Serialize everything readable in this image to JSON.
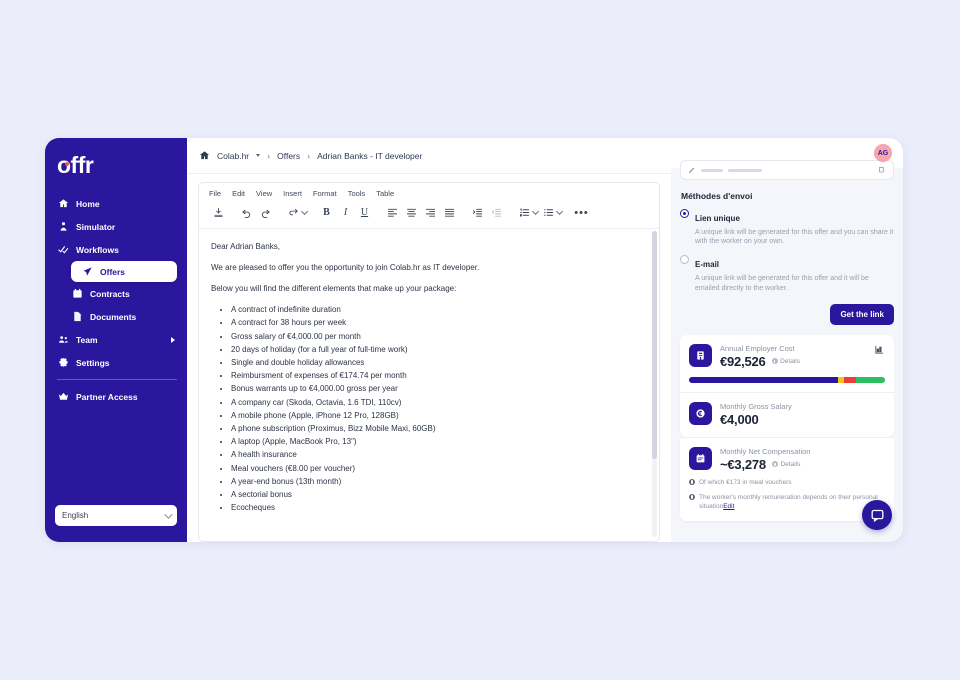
{
  "theme": {
    "brand": "#2b169e",
    "page_bg": "#ecedfb",
    "panel_bg": "#f5f6fb",
    "avatar_bg": "#f7a5ae",
    "accent_orange": "#f0593f"
  },
  "sidebar": {
    "logo_text": "offr",
    "items": [
      {
        "label": "Home",
        "icon": "home-icon",
        "level": 0,
        "active": false
      },
      {
        "label": "Simulator",
        "icon": "user-simulator-icon",
        "level": 0,
        "active": false
      },
      {
        "label": "Workflows",
        "icon": "workflows-icon",
        "level": 0,
        "active": false
      },
      {
        "label": "Offers",
        "icon": "paper-plane-icon",
        "level": 1,
        "active": true
      },
      {
        "label": "Contracts",
        "icon": "calendar-icon",
        "level": 1,
        "active": false
      },
      {
        "label": "Documents",
        "icon": "document-edit-icon",
        "level": 1,
        "active": false
      },
      {
        "label": "Team",
        "icon": "people-icon",
        "level": 0,
        "active": false,
        "has_chevron": true
      },
      {
        "label": "Settings",
        "icon": "gear-icon",
        "level": 0,
        "active": false
      }
    ],
    "footer_items": [
      {
        "label": "Partner Access",
        "icon": "crown-icon"
      }
    ],
    "language": {
      "value": "English",
      "chevron": "chevron-down-icon"
    }
  },
  "breadcrumb": {
    "home_icon": "home-icon",
    "items": [
      "Colab.hr",
      "Offers",
      "Adrian Banks - IT developer"
    ],
    "separator": "›"
  },
  "topbar": {
    "avatar_initials": "AG"
  },
  "editor": {
    "menus": [
      "File",
      "Edit",
      "View",
      "Insert",
      "Format",
      "Tools",
      "Table"
    ],
    "toolbar": [
      {
        "name": "save-icon",
        "label": ""
      },
      {
        "name": "undo-icon",
        "label": ""
      },
      {
        "name": "redo-icon",
        "label": ""
      },
      {
        "name": "merge-field-icon",
        "label": ""
      },
      {
        "name": "bold-button",
        "label": "B"
      },
      {
        "name": "italic-button",
        "label": "I"
      },
      {
        "name": "underline-button",
        "label": "U"
      },
      {
        "name": "align-left-icon",
        "label": ""
      },
      {
        "name": "align-center-icon",
        "label": ""
      },
      {
        "name": "align-right-icon",
        "label": ""
      },
      {
        "name": "align-justify-icon",
        "label": ""
      },
      {
        "name": "indent-increase-icon",
        "label": ""
      },
      {
        "name": "indent-decrease-icon",
        "label": ""
      },
      {
        "name": "ordered-list-icon",
        "label": ""
      },
      {
        "name": "bullet-list-icon",
        "label": ""
      },
      {
        "name": "more-options-icon",
        "label": "•••"
      }
    ],
    "document": {
      "greeting": "Dear Adrian Banks,",
      "intro": "We are pleased to offer you the opportunity to join Colab.hr as IT developer.",
      "lead_in": "Below you will find the different elements that make up your package:",
      "bullets": [
        "A contract of indefinite duration",
        "A contract for 38 hours per week",
        "Gross salary of €4,000.00 per month",
        "20 days of holiday (for a full year of full-time work)",
        "Single and double holiday allowances",
        "Reimbursment of expenses of €174.74 per month",
        "Bonus warrants up to €4,000.00 gross per year",
        "A company car (Skoda, Octavia, 1.6 TDI, 110cv)",
        "A mobile phone (Apple, iPhone 12 Pro, 128GB)",
        "A phone subscription (Proximus, Bizz Mobile Maxi, 60GB)",
        "A laptop (Apple, MacBook Pro, 13\")",
        "A health insurance",
        "Meal vouchers (€8.00 per voucher)",
        "A year-end bonus (13th month)",
        "A sectorial bonus",
        "Ecocheques"
      ]
    }
  },
  "right_panel": {
    "send_methods_title": "Méthodes d'envoi",
    "options": [
      {
        "label": "Lien unique",
        "description": "A unique link will be generated for this offer and you can share it with the worker on your own.",
        "selected": true
      },
      {
        "label": "E-mail",
        "description": "A unique link will be generated for this offer and it will be emailed directly to the worker.",
        "selected": false
      }
    ],
    "primary_button": "Get the link",
    "cards": [
      {
        "icon": "bank-building-icon",
        "label": "Annual Employer Cost",
        "amount": "€92,526",
        "details_label": "Details",
        "chart_icon": "bar-chart-icon",
        "progress": [
          {
            "color": "#2b169e",
            "pct": 76
          },
          {
            "color": "#f5c518",
            "pct": 3
          },
          {
            "color": "#ef3b3b",
            "pct": 6
          },
          {
            "color": "#2dbe60",
            "pct": 15
          }
        ]
      },
      {
        "icon": "euro-coin-icon",
        "label": "Monthly Gross Salary",
        "amount": "€4,000"
      },
      {
        "icon": "calendar-icon",
        "label": "Monthly Net Compensation",
        "amount": "~€3,278",
        "details_label": "Details",
        "notes": [
          {
            "text": "Of which €173 in meal vouchers"
          },
          {
            "text": "The worker's monthly remuneration depends on their personal situation",
            "link": "Edit"
          }
        ]
      }
    ],
    "chat_fab": "chat-bubble-icon"
  }
}
